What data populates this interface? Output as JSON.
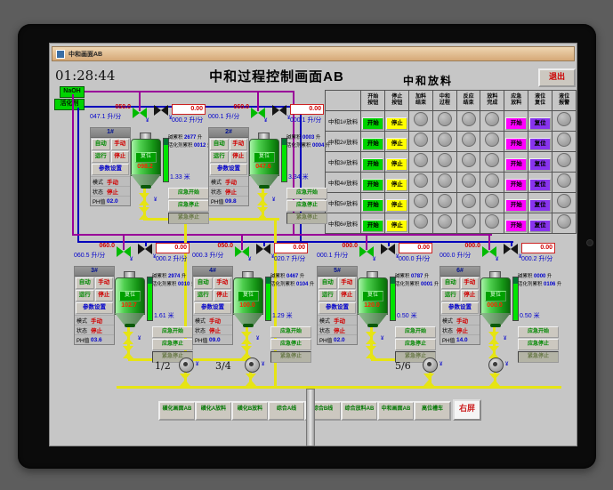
{
  "window": {
    "title": "中和画面AB"
  },
  "header": {
    "time": "01:28:44",
    "title": "中和过程控制画面AB",
    "table_title": "中和放料",
    "exit": "退出"
  },
  "supplies": {
    "naoh": "NaOH",
    "activator": "活化剂"
  },
  "discharge_table": {
    "columns": [
      "开始\n按钮",
      "停止\n按钮",
      "加料\n结束",
      "中和\n过程",
      "反应\n结束",
      "放料\n完成",
      "应急\n放料",
      "液位\n复位",
      "液位\n报警"
    ],
    "rows": [
      {
        "label": "中和1#放料"
      },
      {
        "label": "中和2#放料"
      },
      {
        "label": "中和3#放料"
      },
      {
        "label": "中和4#放料"
      },
      {
        "label": "中和5#放料"
      },
      {
        "label": "中和6#放料"
      }
    ],
    "start_label": "开始",
    "stop_label": "停止",
    "emergency_label": "开始",
    "reset_label": "复位"
  },
  "tank_labels": {
    "auto": "自动",
    "manual": "手动",
    "run": "运行",
    "stop": "停止",
    "params": "参数设置",
    "mode": "模式",
    "state": "状态",
    "ph": "PH值",
    "mode_value": "手动",
    "state_value": "停止",
    "alkali_total": "碱累积",
    "activator_total": "活化剂累积",
    "total_unit": "升",
    "flow_unit": "升/分",
    "level_unit": "米",
    "reset": "复位",
    "em_start": "应急开始",
    "em_stop": "应急停止",
    "em_estop": "紧急停止"
  },
  "tanks": [
    {
      "id": "1#",
      "sp": "050.0",
      "pv": "047.1",
      "act_sp": "0.00",
      "act_pv": "000.2",
      "alkali_total": "2677",
      "act_total": "0012",
      "value": "098.2",
      "level": "1.33",
      "ph": "02.0"
    },
    {
      "id": "2#",
      "sp": "060.0",
      "pv": "000.1",
      "act_sp": "0.00",
      "act_pv": "000.1",
      "alkali_total": "0003",
      "act_total": "0004",
      "value": "047.6",
      "level": "3.34",
      "ph": "09.8"
    },
    {
      "id": "3#",
      "sp": "060.0",
      "pv": "060.5",
      "act_sp": "0.00",
      "act_pv": "000.2",
      "alkali_total": "2974",
      "act_total": "0010",
      "value": "102.7",
      "level": "1.61",
      "ph": "03.6"
    },
    {
      "id": "4#",
      "sp": "050.0",
      "pv": "000.3",
      "act_sp": "0.00",
      "act_pv": "020.7",
      "alkali_total": "0467",
      "act_total": "0104",
      "value": "100.0",
      "level": "1.29",
      "ph": "09.0"
    },
    {
      "id": "5#",
      "sp": "000.0",
      "pv": "000.1",
      "act_sp": "0.00",
      "act_pv": "000.0",
      "alkali_total": "0787",
      "act_total": "0001",
      "value": "120.0",
      "level": "0.50",
      "ph": "02.0"
    },
    {
      "id": "6#",
      "sp": "000.0",
      "pv": "000.0",
      "act_sp": "0.00",
      "act_pv": "000.2",
      "alkali_total": "0000",
      "act_total": "0106",
      "value": "000.0",
      "level": "0.50",
      "ph": "14.0"
    }
  ],
  "pumps": [
    {
      "label": "1/2"
    },
    {
      "label": "3/4"
    },
    {
      "label": "5/6"
    },
    {
      "label": ""
    }
  ],
  "nav": [
    "磺化画面AB",
    "磺化A放料",
    "磺化B放料",
    "综合A线",
    "综合B线",
    "综合放料AB",
    "中和画面AB",
    "高位槽车"
  ],
  "nav_right": "右屏",
  "colors": {
    "start_green": "#00d400",
    "stop_yellow": "#ffff00",
    "emergency_magenta": "#ff00ff",
    "reset_purple": "#8833ee",
    "pipe_naoh": "#990099",
    "pipe_activator": "#0000bb",
    "pipe_product": "#e6e414"
  }
}
